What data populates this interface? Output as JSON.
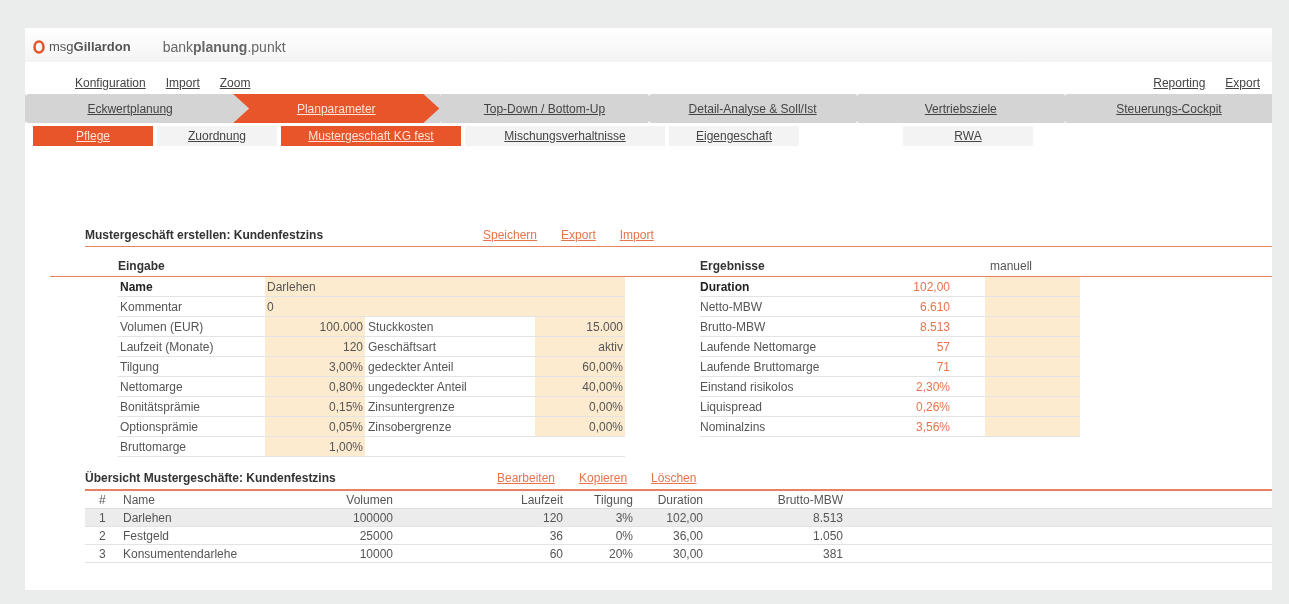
{
  "header": {
    "logo_text": "msg**Gillardon**",
    "product": "bank**planung**.punkt"
  },
  "menu_left": [
    "Konfiguration",
    "Import",
    "Zoom"
  ],
  "menu_right": [
    "Reporting",
    "Export"
  ],
  "process_tabs": [
    {
      "label": "Eckwertplanung",
      "selected": false
    },
    {
      "label": "Planparameter",
      "selected": true
    },
    {
      "label": "Top-Down / Bottom-Up",
      "selected": false
    },
    {
      "label": "Detail-Analyse & Soll/Ist",
      "selected": false
    },
    {
      "label": "Vertriebsziele",
      "selected": false
    },
    {
      "label": "Steuerungs-Cockpit",
      "selected": false
    }
  ],
  "sub_tabs": [
    {
      "label": "Pflege",
      "selected": true
    },
    {
      "label": "Zuordnung",
      "selected": false
    },
    {
      "label": "Mustergeschaft KG fest",
      "selected": true
    },
    {
      "label": "Mischungsverhaltnisse",
      "selected": false
    },
    {
      "label": "Eigengeschaft",
      "selected": false
    },
    {
      "label": "RWA",
      "selected": false
    }
  ],
  "create_section": {
    "title": "Mustergeschäft erstellen: Kundenfestzins",
    "actions": [
      "Speichern",
      "Export",
      "Import"
    ],
    "input": {
      "heading": "Eingabe",
      "rows": [
        {
          "kind": "wide",
          "bold": true,
          "label": "Name",
          "value": "Darlehen"
        },
        {
          "kind": "wide",
          "bold": false,
          "label": "Kommentar",
          "value": "0"
        },
        {
          "kind": "pair",
          "bold": false,
          "label": "Volumen (EUR)",
          "value": "100.000",
          "label2": "Stuckkosten",
          "value2": "15.000"
        },
        {
          "kind": "pair",
          "bold": false,
          "label": "Laufzeit (Monate)",
          "value": "120",
          "label2": "Geschäftsart",
          "value2": "aktiv"
        },
        {
          "kind": "pair",
          "bold": false,
          "label": "Tilgung",
          "value": "3,00%",
          "label2": "gedeckter Anteil",
          "value2": "60,00%"
        },
        {
          "kind": "pair",
          "bold": false,
          "label": "Nettomarge",
          "value": "0,80%",
          "label2": "ungedeckter Anteil",
          "value2": "40,00%"
        },
        {
          "kind": "pair",
          "bold": false,
          "label": "Bonitätsprämie",
          "value": "0,15%",
          "label2": "Zinsuntergrenze",
          "value2": "0,00%"
        },
        {
          "kind": "pair",
          "bold": false,
          "label": "Optionsprämie",
          "value": "0,05%",
          "label2": "Zinsobergrenze",
          "value2": "0,00%"
        },
        {
          "kind": "single",
          "bold": false,
          "label": "Bruttomarge",
          "value": "1,00%"
        }
      ]
    },
    "results": {
      "heading": "Ergebnisse",
      "manual_heading": "manuell",
      "rows": [
        {
          "bold": true,
          "label": "Duration",
          "value": "102,00"
        },
        {
          "bold": false,
          "label": "Netto-MBW",
          "value": "6.610"
        },
        {
          "bold": false,
          "label": "Brutto-MBW",
          "value": "8.513"
        },
        {
          "bold": false,
          "label": "Laufende Nettomarge",
          "value": "57"
        },
        {
          "bold": false,
          "label": "Laufende Bruttomarge",
          "value": "71"
        },
        {
          "bold": false,
          "label": "Einstand risikolos",
          "value": "2,30%"
        },
        {
          "bold": false,
          "label": "Liquispread",
          "value": "0,26%"
        },
        {
          "bold": false,
          "label": "Nominalzins",
          "value": "3,56%"
        }
      ]
    }
  },
  "overview": {
    "title": "Übersicht Mustergeschäfte: Kundenfestzins",
    "actions": [
      "Bearbeiten",
      "Kopieren",
      "Löschen"
    ],
    "table": {
      "columns": [
        "#",
        "Name",
        "Volumen",
        "Laufzeit",
        "Tilgung",
        "Duration",
        "Brutto-MBW"
      ],
      "rows": [
        {
          "selected": true,
          "cells": [
            "1",
            "Darlehen",
            "100000",
            "120",
            "3%",
            "102,00",
            "8.513"
          ]
        },
        {
          "selected": false,
          "cells": [
            "2",
            "Festgeld",
            "25000",
            "36",
            "0%",
            "36,00",
            "1.050"
          ]
        },
        {
          "selected": false,
          "cells": [
            "3",
            "Konsumentendarlehe",
            "10000",
            "60",
            "20%",
            "30,00",
            "381"
          ]
        }
      ]
    }
  }
}
